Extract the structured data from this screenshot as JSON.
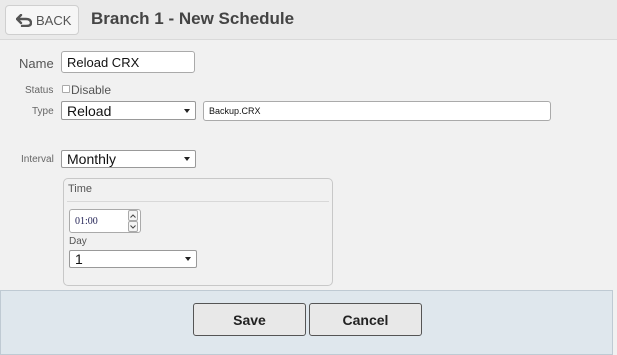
{
  "header": {
    "back_label": "BACK",
    "title": "Branch 1 - New Schedule"
  },
  "form": {
    "name_label": "Name",
    "name_value": "Reload CRX",
    "status_label": "Status",
    "disable_label": "Disable",
    "disable_checked": false,
    "type_label": "Type",
    "type_value": "Reload",
    "file_value": "Backup.CRX",
    "interval_label": "Interval",
    "interval_value": "Monthly"
  },
  "time_panel": {
    "legend": "Time",
    "time_value": "01:00",
    "day_label": "Day",
    "day_value": "1"
  },
  "footer": {
    "save_label": "Save",
    "cancel_label": "Cancel"
  },
  "icons": {
    "back": "undo-arrow-icon",
    "dropdown": "caret-down-icon",
    "spin_up": "chevron-up-icon",
    "spin_down": "chevron-down-icon"
  },
  "colors": {
    "footer_background": "#dfe7ed",
    "page_background": "#f1f1f1"
  }
}
